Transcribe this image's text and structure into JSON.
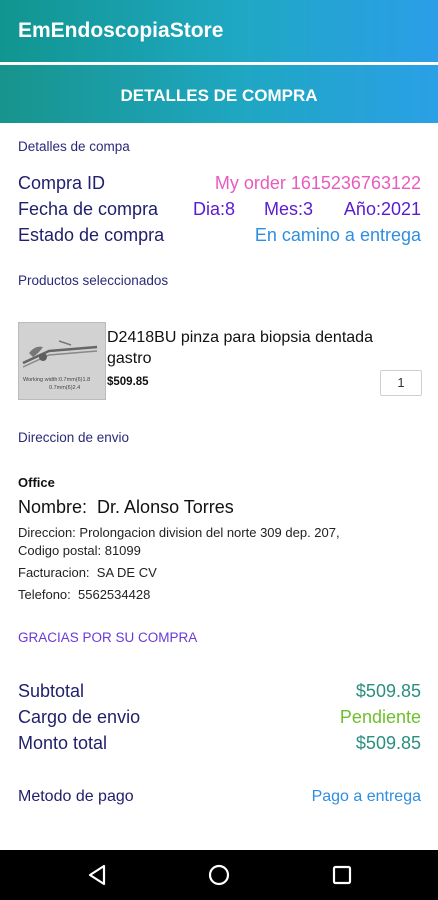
{
  "app": {
    "title": "EmEndoscopiaStore"
  },
  "header": {
    "title": "DETALLES DE COMPRA"
  },
  "details": {
    "section_label": "Detalles de compa",
    "compra_id_label": "Compra ID",
    "compra_id_value": "My order 1615236763122",
    "fecha_label": "Fecha de compra",
    "dia": "Dia:8",
    "mes": "Mes:3",
    "anio": "Año:2021",
    "estado_label": "Estado de compra",
    "estado_value": "En camino a entrega"
  },
  "products": {
    "section_label": "Productos seleccionados",
    "items": [
      {
        "name_line1": "D2418BU pinza para biopsia dentada",
        "name_line2": "gastro",
        "price": "$509.85",
        "quantity": "1",
        "image_caption_line1": "Working width:0.7mm(6)1.8",
        "image_caption_line2": "0.7mm(6)2.4"
      }
    ]
  },
  "shipping": {
    "section_label": "Direccion de envio",
    "place": "Office",
    "name_label": "Nombre:",
    "name_value": "Dr. Alonso Torres",
    "address_line1": "Direccion: Prolongacion division del norte 309 dep. 207,",
    "address_line2": "Codigo postal: 81099",
    "billing_label": "Facturacion:",
    "billing_value": "SA DE CV",
    "phone_label": "Telefono:",
    "phone_value": "5562534428"
  },
  "thanks": "GRACIAS POR SU COMPRA",
  "totals": {
    "subtotal_label": "Subtotal",
    "subtotal_value": "$509.85",
    "shipping_label": "Cargo de envio",
    "shipping_value": "Pendiente",
    "total_label": "Monto total",
    "total_value": "$509.85"
  },
  "payment": {
    "label": "Metodo de pago",
    "value": "Pago a entrega"
  },
  "navbar": {
    "back_icon": "back-triangle-icon",
    "home_icon": "home-circle-icon",
    "recents_icon": "recents-square-icon"
  }
}
